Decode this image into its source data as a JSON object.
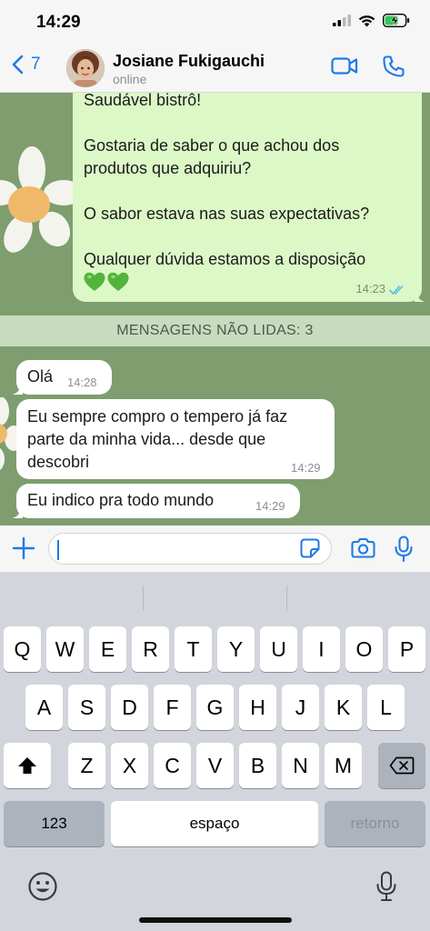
{
  "status_bar": {
    "time": "14:29"
  },
  "header": {
    "back_count": "7",
    "contact_name": "Josiane Fukigauchi",
    "contact_status": "online"
  },
  "outgoing": {
    "lines": [
      "Saudável bistrô!",
      "Gostaria de saber o que achou dos",
      "produtos que adquiriu?",
      "O sabor estava nas suas expectativas?",
      "Qualquer dúvida estamos a disposição"
    ],
    "emoji": [
      "💚",
      "💚"
    ],
    "time": "14:23"
  },
  "unread_banner": "MENSAGENS NÃO LIDAS: 3",
  "incoming": [
    {
      "lines": [
        "Olá"
      ],
      "time": "14:28"
    },
    {
      "lines": [
        "Eu sempre compro o tempero já faz",
        "parte da minha vida... desde que",
        "descobri"
      ],
      "time": "14:29"
    },
    {
      "lines": [
        "Eu indico pra todo mundo"
      ],
      "time": "14:29"
    }
  ],
  "input": {
    "value": ""
  },
  "keyboard": {
    "row1": [
      "Q",
      "W",
      "E",
      "R",
      "T",
      "Y",
      "U",
      "I",
      "O",
      "P"
    ],
    "row2": [
      "A",
      "S",
      "D",
      "F",
      "G",
      "H",
      "J",
      "K",
      "L"
    ],
    "row3": [
      "Z",
      "X",
      "C",
      "V",
      "B",
      "N",
      "M"
    ],
    "numbers_key": "123",
    "space_key": "espaço",
    "return_key": "retorno"
  },
  "colors": {
    "accent": "#1f7ae6",
    "chat_bg": "#7e9e6f",
    "outgoing_bubble": "#dcf8c6",
    "read_ticks": "#53bdeb"
  },
  "icons": {
    "back": "chevron-left-icon",
    "video": "video-camera-icon",
    "call": "phone-icon",
    "add": "plus-icon",
    "sticker": "sticker-icon",
    "camera": "camera-icon",
    "mic": "microphone-icon",
    "shift": "shift-icon",
    "delete": "backspace-icon",
    "emoji": "emoji-icon"
  }
}
